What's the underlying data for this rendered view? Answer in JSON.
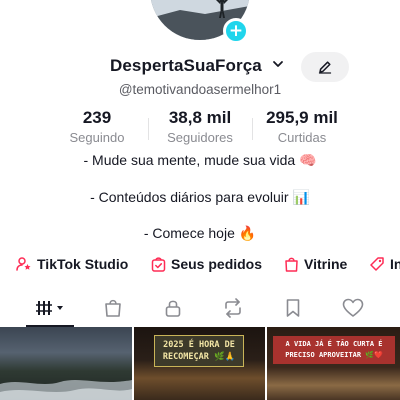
{
  "profile": {
    "username": "DespertaSuaForça",
    "handle": "@temotivandoasermelhor1",
    "username_chevron_icon": "chevron-down-icon",
    "edit_icon": "pencil-icon",
    "avatar_add_icon": "plus-icon",
    "avatar_add_glyph": "+",
    "accent_color": "#20d5ec"
  },
  "stats": [
    {
      "value": "239",
      "label": "Seguindo"
    },
    {
      "value": "38,8 mil",
      "label": "Seguidores"
    },
    {
      "value": "295,9 mil",
      "label": "Curtidas"
    }
  ],
  "bio": [
    "- Mude sua mente, mude sua vida 🧠",
    "- Conteúdos diários para evoluir 📊",
    "- Comece hoje 🔥"
  ],
  "links": [
    {
      "label": "TikTok Studio",
      "icon": "person-star-icon"
    },
    {
      "label": "Seus pedidos",
      "icon": "order-bag-icon"
    },
    {
      "label": "Vitrine",
      "icon": "shop-bag-icon"
    },
    {
      "label": "In",
      "icon": "tag-icon"
    }
  ],
  "tabs": [
    {
      "name": "videos",
      "icon": "grid-bars-icon",
      "selected": true
    },
    {
      "name": "shop",
      "icon": "bag-icon"
    },
    {
      "name": "private",
      "icon": "lock-icon"
    },
    {
      "name": "reposts",
      "icon": "repost-icon"
    },
    {
      "name": "favorites",
      "icon": "bookmark-icon"
    },
    {
      "name": "liked",
      "icon": "heart-icon"
    }
  ],
  "videos": [
    {
      "caption": ""
    },
    {
      "caption": "2025 É HORA DE RECOMEÇAR 🌿🙏"
    },
    {
      "caption": "A VIDA JÁ É TÃO CURTA É PRECISO APROVEITAR 🌿❤️"
    }
  ]
}
